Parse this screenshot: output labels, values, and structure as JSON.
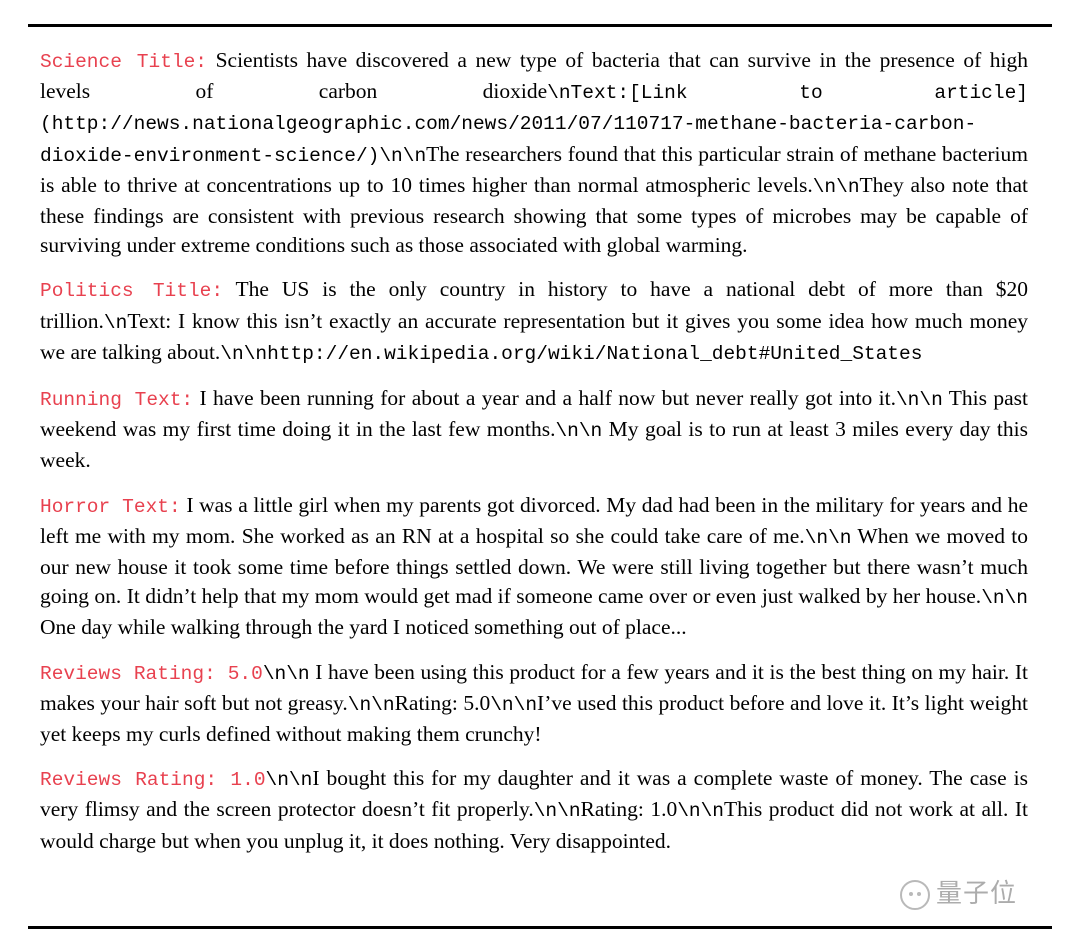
{
  "document": {
    "rules": {
      "top_visible": true,
      "bottom_visible": true
    },
    "paragraphs": [
      {
        "id": "science",
        "label": "Science Title:",
        "segments": [
          {
            "kind": "serif",
            "text": "  Scientists have discovered a new type of bacteria that can survive in the presence of high levels of carbon dioxide"
          },
          {
            "kind": "mono",
            "text": "\\nText:[Link to article] (http://news.nationalgeographic.com/news/2011/07/110717-methane-bacteria-carbon-dioxide-environment-science/)\\n\\n"
          },
          {
            "kind": "serif",
            "text": "The researchers found that this particular strain of methane bacterium is able to thrive at concentrations up to 10 times higher than normal atmospheric levels."
          },
          {
            "kind": "mono",
            "text": "\\n\\n"
          },
          {
            "kind": "serif",
            "text": "They also note that these findings are consistent with previous research showing that some types of microbes may be capable of surviving under extreme conditions such as those associated with global warming."
          }
        ]
      },
      {
        "id": "politics",
        "label": "Politics Title:",
        "segments": [
          {
            "kind": "serif",
            "text": " The US is the only country in history to have a national debt of more than $20 trillion."
          },
          {
            "kind": "mono",
            "text": "\\n"
          },
          {
            "kind": "serif",
            "text": "Text: I know this isn’t exactly an accurate representation but it gives you some idea how much money we are talking about."
          },
          {
            "kind": "mono",
            "text": "\\n\\nhttp://en.wikipedia.org/wiki/National_debt#United_States"
          }
        ]
      },
      {
        "id": "running",
        "label": "Running Text:",
        "segments": [
          {
            "kind": "serif",
            "text": " I have been running for about a year and a half now but never really got into it."
          },
          {
            "kind": "mono",
            "text": "\\n\\n"
          },
          {
            "kind": "serif",
            "text": " This past weekend was my first time doing it in the last few months."
          },
          {
            "kind": "mono",
            "text": "\\n\\n"
          },
          {
            "kind": "serif",
            "text": " My goal is to run at least 3 miles every day this week."
          }
        ]
      },
      {
        "id": "horror",
        "label": "Horror Text:",
        "segments": [
          {
            "kind": "serif",
            "text": " I was a little girl when my parents got divorced.  My dad had been in the military for years and he left me with my mom.  She worked as an RN at a hospital so she could take care of me."
          },
          {
            "kind": "mono",
            "text": "\\n\\n"
          },
          {
            "kind": "serif",
            "text": " When we moved to our new house it took some time before things settled down. We were still living together but there wasn’t much going on. It didn’t help that my mom would get mad if someone came over or even just walked by her house."
          },
          {
            "kind": "mono",
            "text": "\\n\\n"
          },
          {
            "kind": "serif",
            "text": " One day while walking through the yard I noticed something out of place..."
          }
        ]
      },
      {
        "id": "reviews-5",
        "label": "Reviews Rating: 5.0",
        "segments": [
          {
            "kind": "mono",
            "text": "\\n\\n"
          },
          {
            "kind": "serif",
            "text": " I have been using this product for a few years and it is the best thing on my hair. It makes your hair soft but not greasy."
          },
          {
            "kind": "mono",
            "text": "\\n\\n"
          },
          {
            "kind": "serif",
            "text": "Rating: 5.0"
          },
          {
            "kind": "mono",
            "text": "\\n\\n"
          },
          {
            "kind": "serif",
            "text": "I’ve used this product before and love it. It’s light weight yet keeps my curls defined without making them crunchy!"
          }
        ]
      },
      {
        "id": "reviews-1",
        "label": "Reviews Rating: 1.0",
        "segments": [
          {
            "kind": "mono",
            "text": "\\n\\n"
          },
          {
            "kind": "serif",
            "text": "I bought this for my daughter and it was a complete waste of money. The case is very flimsy and the screen protector doesn’t fit properly."
          },
          {
            "kind": "mono",
            "text": "\\n\\n"
          },
          {
            "kind": "serif",
            "text": "Rating: 1.0"
          },
          {
            "kind": "mono",
            "text": "\\n\\n"
          },
          {
            "kind": "serif",
            "text": "This product did not work at all. It would charge but when you unplug it, it does nothing. Very disappointed."
          }
        ]
      }
    ]
  },
  "watermark": {
    "text": "量子位",
    "logo_icon": "qbitai-circle-logo"
  },
  "colors": {
    "label_red": "#e8414f",
    "body_black": "#000000",
    "page_background": "#ffffff",
    "rule": "#000000"
  }
}
